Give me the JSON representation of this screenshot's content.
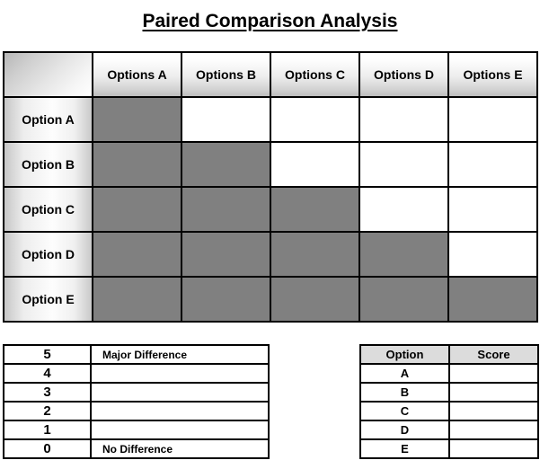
{
  "document": {
    "title": "Paired Comparison Analysis"
  },
  "matrix": {
    "corner_label": "",
    "column_headers": [
      "Options A",
      "Options B",
      "Options C",
      "Options D",
      "Options E"
    ],
    "rows": [
      {
        "label": "Option A",
        "cells": [
          "filled",
          "empty",
          "empty",
          "empty",
          "empty"
        ]
      },
      {
        "label": "Option B",
        "cells": [
          "filled",
          "filled",
          "empty",
          "empty",
          "empty"
        ]
      },
      {
        "label": "Option C",
        "cells": [
          "filled",
          "filled",
          "filled",
          "empty",
          "empty"
        ]
      },
      {
        "label": "Option D",
        "cells": [
          "filled",
          "filled",
          "filled",
          "filled",
          "empty"
        ]
      },
      {
        "label": "Option E",
        "cells": [
          "filled",
          "filled",
          "filled",
          "filled",
          "filled"
        ]
      }
    ],
    "filled_color": "#808080",
    "empty_color": "#ffffff"
  },
  "legend": {
    "rows": [
      {
        "score": "5",
        "description": "Major Difference"
      },
      {
        "score": "4",
        "description": ""
      },
      {
        "score": "3",
        "description": ""
      },
      {
        "score": "2",
        "description": ""
      },
      {
        "score": "1",
        "description": ""
      },
      {
        "score": "0",
        "description": "No Difference"
      }
    ]
  },
  "scores": {
    "headers": {
      "option": "Option",
      "score": "Score"
    },
    "rows": [
      {
        "option": "A",
        "score": ""
      },
      {
        "option": "B",
        "score": ""
      },
      {
        "option": "C",
        "score": ""
      },
      {
        "option": "D",
        "score": ""
      },
      {
        "option": "E",
        "score": ""
      }
    ],
    "header_bg": "#dcdcdc"
  }
}
